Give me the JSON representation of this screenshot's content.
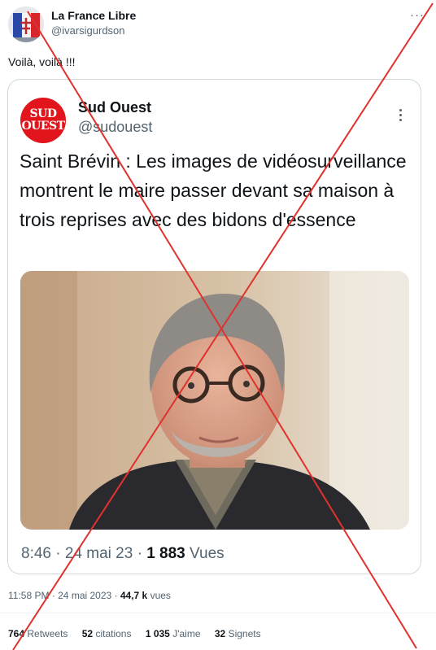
{
  "author": {
    "name": "La France Libre",
    "handle": "@ivarsigurdson"
  },
  "tweet": {
    "text": "Voilà, voilà !!!"
  },
  "quoted": {
    "logo_line1": "SUD",
    "logo_line2": "OUEST",
    "name": "Sud Ouest",
    "handle": "@sudouest",
    "text": "Saint Brévin : Les images de vidéosurveillance montrent le maire passer devant sa maison à trois reprises avec des bidons d'essence",
    "time_date": "8:46 · 24 mai 23 · ",
    "views_count": "1 883",
    "views_label": "Vues"
  },
  "meta": {
    "time_date": "11:58 PM · 24 mai 2023 · ",
    "views_count": "44,7 k",
    "views_label": "vues"
  },
  "stats": {
    "retweets_count": "764",
    "retweets_label": "Retweets",
    "citations_count": "52",
    "citations_label": "citations",
    "likes_count": "1 035",
    "likes_label": "J'aime",
    "bookmarks_count": "32",
    "bookmarks_label": "Signets"
  },
  "colors": {
    "cross_red": "#e0322d",
    "logo_red": "#e1151b",
    "text_primary": "#0f1419",
    "text_secondary": "#536471"
  }
}
